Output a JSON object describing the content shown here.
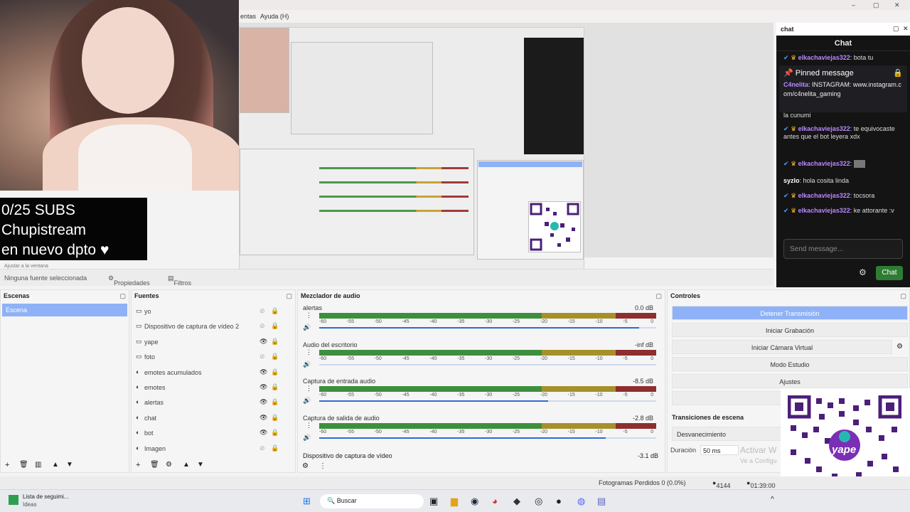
{
  "menubar": {
    "partial_item": "entas",
    "help": "Ayuda (H)"
  },
  "window": {
    "min": "–",
    "max": "▢",
    "close": "✕"
  },
  "overlay": {
    "subs": "0/25 SUBS",
    "name": "Chupistream",
    "status": "en nuevo dpto ♥"
  },
  "chat": {
    "dock_title": "chat",
    "header": "Chat",
    "pinned_label": "Pinned message",
    "pinned_user": "C4nelita",
    "pinned_text": ": INSTAGRAM: www.instagram.com/c4nelita_gaming",
    "prev_user": "elkachaviejas322",
    "prev_text": ": bota tu",
    "prev_tail": "la cunumi",
    "messages": [
      {
        "user": "elkachaviejas322",
        "text": ": te equivocaste antes que el bot leyera xdx"
      },
      {
        "user": "elkachaviejas322",
        "text": ":"
      },
      {
        "user": "syzlo",
        "text": ": hola cosita linda"
      },
      {
        "user": "elkachaviejas322",
        "text": ": tocsora"
      },
      {
        "user": "elkachaviejas322",
        "text": ": ke attorante :v"
      }
    ],
    "send_placeholder": "Send message...",
    "send_button": "Chat"
  },
  "srcbar": {
    "no_source": "Ninguna fuente seleccionada",
    "properties": "Propiedades",
    "filters": "Filtros",
    "fit": "Ajustar a la ventana"
  },
  "scenes": {
    "title": "Escenas",
    "items": [
      "Escena"
    ]
  },
  "sources": {
    "title": "Fuentes",
    "items": [
      "yo",
      "Dispositivo de captura de vídeo 2",
      "yape",
      "foto",
      "emotes acumulados",
      "emotes",
      "alertas",
      "chat",
      "bot",
      "Imagen"
    ]
  },
  "mixer": {
    "title": "Mezclador de audio",
    "ticks": [
      "-60",
      "-55",
      "-50",
      "-45",
      "-40",
      "-35",
      "-30",
      "-25",
      "-20",
      "-15",
      "-10",
      "-5",
      "0"
    ],
    "tracks": [
      {
        "name": "alertas",
        "db": "0.0 dB",
        "volume": 0.95
      },
      {
        "name": "Audio del escritorio",
        "db": "-inf dB",
        "volume": 0.0
      },
      {
        "name": "Captura de entrada audio",
        "db": "-8.5 dB",
        "volume": 0.68
      },
      {
        "name": "Captura de salida de audio",
        "db": "-2.8 dB",
        "volume": 0.85
      }
    ],
    "last_track": {
      "name": "Dispositivo de captura de vídeo",
      "db": "-3.1 dB"
    }
  },
  "controls": {
    "title": "Controles",
    "stop_stream": "Detener Transmisión",
    "record": "Iniciar Grabación",
    "virtual_cam": "Iniciar Cámara Virtual",
    "studio": "Modo Estudio",
    "settings": "Ajustes"
  },
  "transitions": {
    "title": "Transiciones de escena",
    "selected": "Desvanecimiento",
    "duration_label": "Duración",
    "duration": "50 ms"
  },
  "watermark": {
    "line1": "Activar W",
    "line2": "Ve a Configu"
  },
  "status": {
    "frames": "Fotogramas Perdidos 0 (0.0%)",
    "kbps": "4144 kbps",
    "time": "01:39:00"
  },
  "taskbar": {
    "news_title": "Lista de seguimi...",
    "news_sub": "Ideas",
    "search": "Buscar"
  },
  "qr": {
    "brand": "yape"
  },
  "colors": {
    "accent": "#8fb1f7",
    "chat_bg": "#141414",
    "chat_user": "#b888ff",
    "chat_button": "#2e7d32"
  }
}
